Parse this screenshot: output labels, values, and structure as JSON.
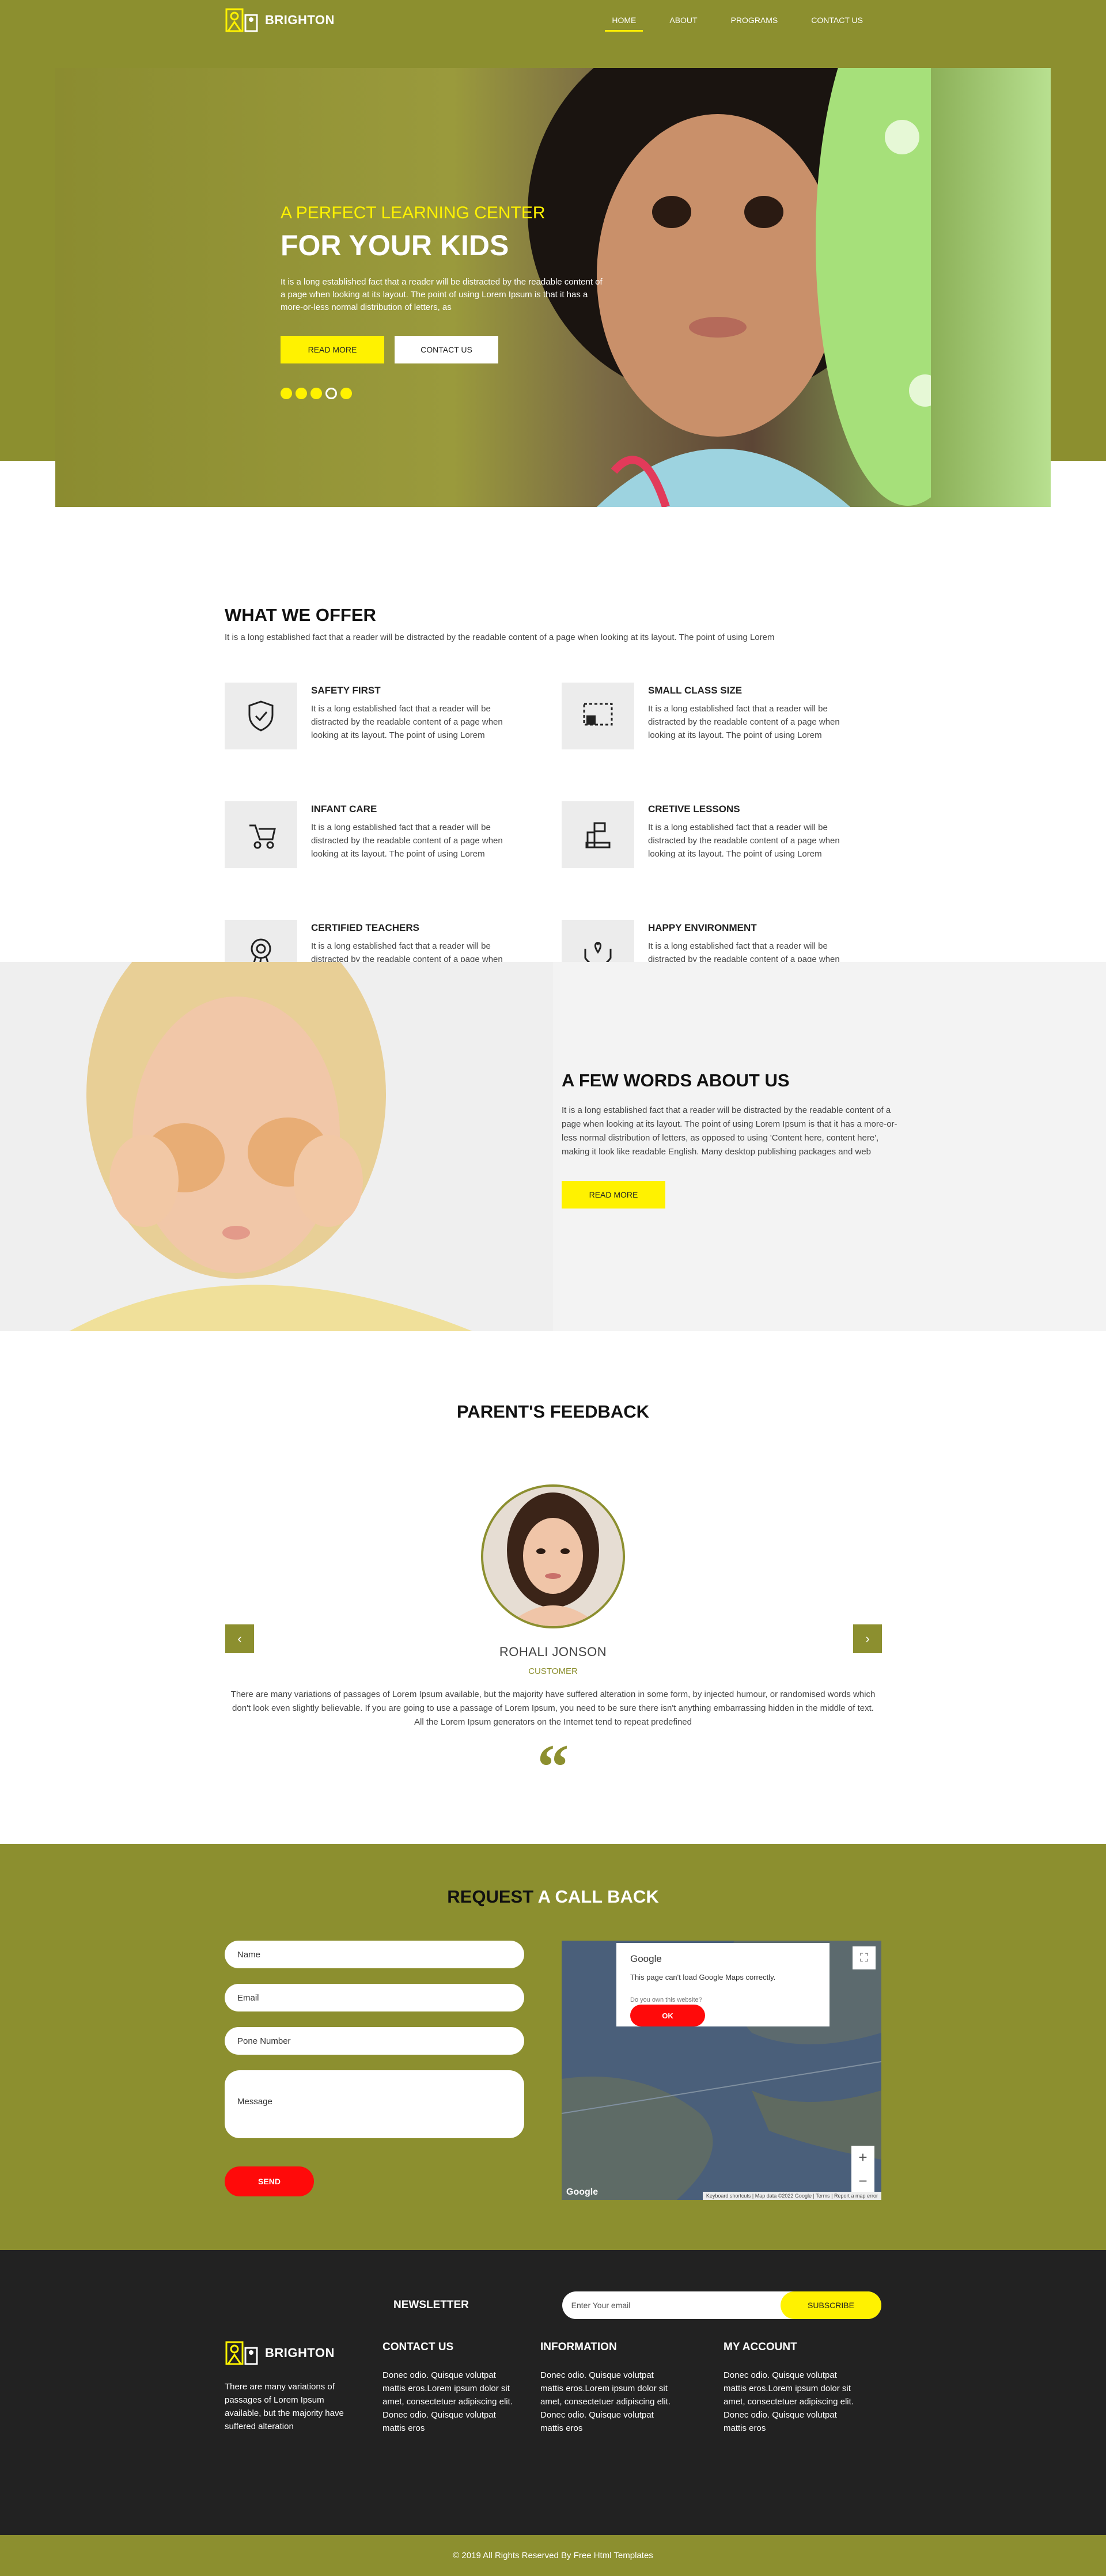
{
  "brand": {
    "name": "BRIGHTON"
  },
  "nav": {
    "items": [
      "HOME",
      "ABOUT",
      "PROGRAMS",
      "CONTACT US"
    ]
  },
  "hero": {
    "subtitle": "A PERFECT LEARNING CENTER",
    "title": "FOR YOUR KIDS",
    "text": "It is a long established fact that a reader will be distracted by the readable content of a page when looking at its layout. The point of using Lorem Ipsum is that it has a more-or-less normal distribution of letters, as",
    "read_more": "READ MORE",
    "contact": "CONTACT US"
  },
  "offer": {
    "title": "WHAT WE OFFER",
    "subtitle": "It is a long established fact that a reader will be distracted by the readable content of a page when looking at its layout. The point of using Lorem",
    "items": [
      {
        "title": "SAFETY FIRST",
        "text": "It is a long established fact that a reader will be distracted by the readable content of a page when looking at its layout. The point of using Lorem",
        "icon": "shield-icon"
      },
      {
        "title": "SMALL CLASS SIZE",
        "text": "It is a long established fact that a reader will be distracted by the readable content of a page when looking at its layout. The point of using Lorem",
        "icon": "whiteboard-icon"
      },
      {
        "title": "INFANT CARE",
        "text": "It is a long established fact that a reader will be distracted by the readable content of a page when looking at its layout. The point of using Lorem",
        "icon": "stroller-icon"
      },
      {
        "title": "CRETIVE LESSONS",
        "text": "It is a long established fact that a reader will be distracted by the readable content of a page when looking at its layout. The point of using Lorem",
        "icon": "lessons-icon"
      },
      {
        "title": "CERTIFIED TEACHERS",
        "text": "It is a long established fact that a reader will be distracted by the readable content of a page when looking at its layout. The point of using Lorem",
        "icon": "award-icon"
      },
      {
        "title": "HAPPY ENVIRONMENT",
        "text": "It is a long established fact that a reader will be distracted by the readable content of a page when looking at its layout. The point of using Lorem",
        "icon": "hands-icon"
      }
    ]
  },
  "about": {
    "title": "A FEW WORDS ABOUT US",
    "text": "It is a long established fact that a reader will be distracted by the readable content of a page when looking at its layout. The point of using Lorem Ipsum is that it has a more-or-less normal distribution of letters, as opposed to using 'Content here, content here', making it look like readable English. Many desktop publishing packages and web",
    "button": "READ MORE"
  },
  "feedback": {
    "title": "PARENT'S FEEDBACK",
    "name": "ROHALI JONSON",
    "role": "CUSTOMER",
    "text": "There are many variations of passages of Lorem Ipsum available, but the majority have suffered alteration in some form, by injected humour, or randomised words which don't look even slightly believable. If you are going to use a passage of Lorem Ipsum, you need to be sure there isn't anything embarrassing hidden in the middle of text. All the Lorem Ipsum generators on the Internet tend to repeat predefined",
    "quote": "“"
  },
  "callback": {
    "title_a": "REQUEST",
    "title_b": "A CALL BACK",
    "name_ph": "Name",
    "email_ph": "Email",
    "phone_ph": "Pone Number",
    "message_ph": "Message",
    "send": "SEND",
    "map_google": "Google",
    "map_error": "This page can't load Google Maps correctly.",
    "map_question": "Do you own this website?",
    "map_ok": "OK",
    "map_footer": "Keyboard shortcuts | Map data ©2022 Google | Terms | Report a map error",
    "map_logo": "Google"
  },
  "footer": {
    "newsletter": "NEWSLETTER",
    "email_ph": "Enter Your email",
    "subscribe": "SUBSCRIBE",
    "brand_text": "There are many variations of passages of Lorem Ipsum available, but the majority have suffered alteration",
    "contact_title": "CONTACT US",
    "contact_text": "Donec odio. Quisque volutpat mattis eros.Lorem ipsum dolor sit amet, consectetuer adipiscing elit. Donec odio. Quisque volutpat mattis eros",
    "info_title": "INFORMATION",
    "info_text": "Donec odio. Quisque volutpat mattis eros.Lorem ipsum dolor sit amet, consectetuer adipiscing elit. Donec odio. Quisque volutpat mattis eros",
    "account_title": "MY ACCOUNT",
    "account_text": "Donec odio. Quisque volutpat mattis eros.Lorem ipsum dolor sit amet, consectetuer adipiscing elit. Donec odio. Quisque volutpat mattis eros",
    "copyright": "© 2019 All Rights Reserved By Free Html Templates"
  },
  "colors": {
    "olive": "#8c8f2f",
    "yellow": "#fff200",
    "red": "#ff0a0a",
    "dark": "#222222"
  }
}
